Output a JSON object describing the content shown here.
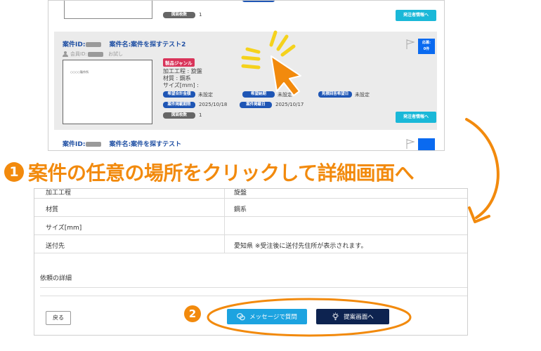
{
  "top": {
    "prev_row": {
      "drawing_count_label": "図面枚数",
      "drawing_count_value": "1",
      "order_info_button": "発注者情報へ"
    },
    "case_main": {
      "case_id_label": "案件ID:",
      "case_name": "案件名:案件を探すテスト2",
      "member_label": "会員ID:",
      "member_suffix": "お試し",
      "thumbnail_text": "○○○○製作所",
      "genre_badge": "製品ジャンル",
      "process": "加工工程 : 旋盤",
      "material": "材質 : 鋼系",
      "size": "サイズ[mm] :",
      "desired_total_label": "希望合計金額",
      "desired_total_value": "未設定",
      "desired_delivery_label": "希望納期",
      "desired_delivery_value": "未設定",
      "quote_response_label": "見積回答希望日",
      "quote_response_value": "未設定",
      "post_deadline_label": "案件掲載期限",
      "post_deadline_value": "2025/10/18",
      "post_date_label": "案件掲載日",
      "post_date_value": "2025/10/17",
      "drawing_count_label": "図面枚数",
      "drawing_count_value": "1",
      "order_info_button": "発注者情報へ",
      "apply_label": "応募:",
      "apply_count": "0件"
    },
    "next_row": {
      "case_id_label": "案件ID:",
      "case_name": "案件名:案件を探すテスト"
    }
  },
  "step1": {
    "number": "1",
    "text": "案件の任意の場所をクリックして詳細画面へ"
  },
  "bottom": {
    "spec_rows": [
      {
        "label": "加工工程",
        "value": "旋盤"
      },
      {
        "label": "材質",
        "value": "鋼系"
      },
      {
        "label": "サイズ[mm]",
        "value": ""
      },
      {
        "label": "送付先",
        "value": "愛知県 ※受注後に送付先住所が表示されます。"
      }
    ],
    "request_details_label": "依頼の詳細",
    "back_button": "戻る",
    "message_button": "メッセージで質問",
    "proposal_button": "提案画面へ"
  },
  "step2": {
    "number": "2"
  },
  "colors": {
    "annotation_orange": "#f28a0d",
    "case_blue": "#1f4fa3",
    "pill_blue": "#1f56b5",
    "order_button_cyan": "#1ab8d8",
    "message_button": "#1ca3e0",
    "proposal_button": "#0d2350",
    "genre_red": "#d9345a"
  },
  "icons": {
    "message": "chat-bubbles-icon",
    "proposal": "lightbulb-icon",
    "flag": "flag-icon",
    "member": "user-icon"
  }
}
